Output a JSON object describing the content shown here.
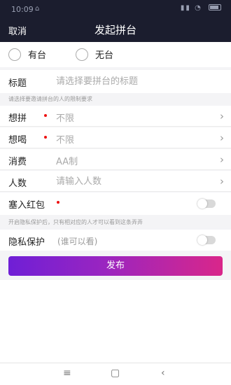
{
  "status_bar": {
    "time": "10:09",
    "signal_left": "⌂",
    "right": "▮▮ ◔"
  },
  "header": {
    "cancel_label": "取消",
    "title": "发起拼台"
  },
  "radio": [
    {
      "label": "有台"
    },
    {
      "label": "无台"
    }
  ],
  "form": {
    "title": {
      "label": "标题",
      "placeholder": "请选择要拼台的标题"
    },
    "restriction_hint": "请选择要邀请拼台的人的限制要求",
    "want_pin": {
      "label": "想拼",
      "value": "不限"
    },
    "want_drink": {
      "label": "想喝",
      "value": "不限"
    },
    "consume": {
      "label": "消费",
      "value": "AA制"
    },
    "people": {
      "label": "人数",
      "placeholder": "请输入人数"
    },
    "red_packet": {
      "label": "塞入红包"
    },
    "privacy_hint": "开启隐私保护后，只有相对应的人才可以看到这条弄弄",
    "privacy": {
      "label": "隐私保护",
      "sub": "(谁可以看)"
    }
  },
  "actions": {
    "publish_label": "发布"
  },
  "navbar": {
    "menu": "≡",
    "home": "▢",
    "back": "‹"
  },
  "colors": {
    "header_bg": "#1b1d2e",
    "gradient_start": "#6f1fd6",
    "gradient_end": "#d9268a",
    "required_dot": "#e11111"
  }
}
